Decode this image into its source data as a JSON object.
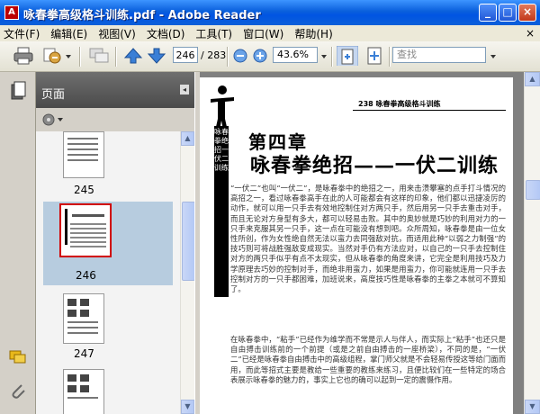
{
  "window": {
    "title": "咏春拳高级格斗训练.pdf - Adobe Reader",
    "app_icon": "adobe-reader-icon",
    "buttons": {
      "minimize": "_",
      "maximize": "□",
      "close": "×"
    }
  },
  "menu": {
    "items": [
      "文件(F)",
      "编辑(E)",
      "视图(V)",
      "文档(D)",
      "工具(T)",
      "窗口(W)",
      "帮助(H)"
    ],
    "close": "×"
  },
  "toolbar": {
    "current_page": "246",
    "total_pages": "/ 283",
    "zoom": "43.6%",
    "search_placeholder": "查找"
  },
  "nav_panel": {
    "title": "页面",
    "thumbnails": [
      {
        "label": "245",
        "selected": false
      },
      {
        "label": "246",
        "selected": true
      },
      {
        "label": "247",
        "selected": false
      }
    ],
    "selection_color": "#b7ccdf"
  },
  "document": {
    "page_header": "238  咏春拳高级格斗训练",
    "chapter": "第四章",
    "chapter_title": "咏春拳绝招——一伏二训练",
    "side_title": "咏春拳绝招一伏二训练",
    "paragraph1": "“一伏二”也叫“一伏二”，是咏春拳中的绝招之一，用来击溃攀塞的点手打斗情况的高招之一，看过咏春拳高手在此的人可能都会有这样的印象，他们都以迅捷凌厉的动作，就可以用一只手去有效地控制住对方两只手，然后用另一只手去重击对手，而且无论对方身型有多大，都可以轻易击败。其中的奥妙就是巧妙的利用对力的一只手来克服其另一只手，这一点在可能没有想到吧。众所周知，咏春拳是由一位女性所创，作为女性绝自然无法以蛮力去同强敌对抗，而适用此种“以弱之力制强”的技巧则可将战胜强敌变成现实。当然对手仍有方法应对，以自己的一只手去控制住对方的两只手似乎有点不太现实，但从咏春拳的角度来讲，它完全是利用技巧及力学原理去巧妙的控制对手，而绝非用蛮力，如果是用蛮力，你可能就连用一只手去控制对方的一只手都困难，加班说来，高度技巧性是咏春拳的主拳之本就可不算知了。",
    "paragraph2": "在咏春拳中，“粘手”已经作为维学而不常是示人与伴人，而实际上“粘手”也还只是自由搏击训练前的一个前提（或是之前自由搏击的一座桥梁），不同的是，“一伏二”已经是咏春拳自由搏击中的高级组程，掌门师父就是不会轻易传授这等给门面而用，而此等招式主要是教给一些重要的教练来练习，且便比较们在一些特定的场合表展示咏春拳的魅力的，事实上它也的确可以起到一定的震慑作用。"
  }
}
